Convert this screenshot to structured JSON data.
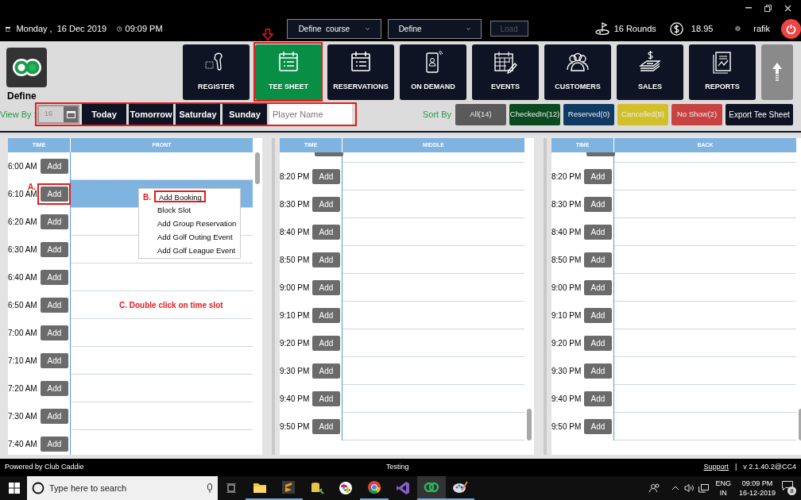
{
  "top_bar": {
    "date": "Monday ,  16 Dec 2019",
    "time": "09:09 PM",
    "course_select": "Define  course",
    "site_select": "Define",
    "load_button": {
      "label": "Load",
      "disabled": true
    },
    "rounds": "16 Rounds",
    "balance": "18.95",
    "user": "rafik"
  },
  "brand": {
    "name": "Define"
  },
  "nav": [
    {
      "label": "REGISTER",
      "selected": false
    },
    {
      "label": "TEE SHEET",
      "selected": true
    },
    {
      "label": "RESERVATIONS",
      "selected": false
    },
    {
      "label": "ON DEMAND",
      "selected": false
    },
    {
      "label": "EVENTS",
      "selected": false
    },
    {
      "label": "CUSTOMERS",
      "selected": false
    },
    {
      "label": "SALES",
      "selected": false
    },
    {
      "label": "REPORTS",
      "selected": false
    }
  ],
  "view_by": {
    "label": "View By :",
    "date_value": "16",
    "buttons": [
      "Today",
      "Tomorrow",
      "Saturday",
      "Sunday"
    ],
    "player_placeholder": "Player Name"
  },
  "sort_by": {
    "label": "Sort By",
    "filters": [
      {
        "label": "All(14)",
        "color": "#5a5a5a"
      },
      {
        "label": "CheckedIn(12)",
        "color": "#0a4a1e"
      },
      {
        "label": "Reserved(0)",
        "color": "#0e3a63"
      },
      {
        "label": "Cancelled(9)",
        "color": "#d2c02a"
      },
      {
        "label": "No Show(2)",
        "color": "#c84242"
      }
    ],
    "export_button": "Export Tee Sheet"
  },
  "panels": [
    {
      "time_header": "TIME",
      "course_header": "FRONT",
      "scrolled": false,
      "rows": [
        {
          "time": "6:00 AM",
          "button": "Add",
          "selected": false
        },
        {
          "time": "6:10 AM",
          "button": "Add",
          "selected": true
        },
        {
          "time": "6:20 AM",
          "button": "Add",
          "selected": false
        },
        {
          "time": "6:30 AM",
          "button": "Add",
          "selected": false
        },
        {
          "time": "6:40 AM",
          "button": "Add",
          "selected": false
        },
        {
          "time": "6:50 AM",
          "button": "Add",
          "selected": false
        },
        {
          "time": "7:00 AM",
          "button": "Add",
          "selected": false
        },
        {
          "time": "7:10 AM",
          "button": "Add",
          "selected": false
        },
        {
          "time": "7:20 AM",
          "button": "Add",
          "selected": false
        },
        {
          "time": "7:30 AM",
          "button": "Add",
          "selected": false
        },
        {
          "time": "7:40 AM",
          "button": "Add",
          "selected": false
        }
      ]
    },
    {
      "time_header": "TIME",
      "course_header": "MIDDLE",
      "scrolled": true,
      "rows": [
        {
          "time": "8:20 PM",
          "button": "Add",
          "selected": false
        },
        {
          "time": "8:30 PM",
          "button": "Add",
          "selected": false
        },
        {
          "time": "8:40 PM",
          "button": "Add",
          "selected": false
        },
        {
          "time": "8:50 PM",
          "button": "Add",
          "selected": false
        },
        {
          "time": "9:00 PM",
          "button": "Add",
          "selected": false
        },
        {
          "time": "9:10 PM",
          "button": "Add",
          "selected": false
        },
        {
          "time": "9:20 PM",
          "button": "Add",
          "selected": false
        },
        {
          "time": "9:30 PM",
          "button": "Add",
          "selected": false
        },
        {
          "time": "9:40 PM",
          "button": "Add",
          "selected": false
        },
        {
          "time": "9:50 PM",
          "button": "Add",
          "selected": false
        }
      ]
    },
    {
      "time_header": "TIME",
      "course_header": "BACK",
      "scrolled": true,
      "rows": [
        {
          "time": "8:20 PM",
          "button": "Add",
          "selected": false
        },
        {
          "time": "8:30 PM",
          "button": "Add",
          "selected": false
        },
        {
          "time": "8:40 PM",
          "button": "Add",
          "selected": false
        },
        {
          "time": "8:50 PM",
          "button": "Add",
          "selected": false
        },
        {
          "time": "9:00 PM",
          "button": "Add",
          "selected": false
        },
        {
          "time": "9:10 PM",
          "button": "Add",
          "selected": false
        },
        {
          "time": "9:20 PM",
          "button": "Add",
          "selected": false
        },
        {
          "time": "9:30 PM",
          "button": "Add",
          "selected": false
        },
        {
          "time": "9:40 PM",
          "button": "Add",
          "selected": false
        },
        {
          "time": "9:50 PM",
          "button": "Add",
          "selected": false
        }
      ]
    }
  ],
  "context_menu": {
    "items": [
      {
        "label": "Add Booking",
        "selected": true
      },
      {
        "label": "Block Slot",
        "selected": false
      },
      {
        "label": "Add Group Reservation",
        "selected": false
      },
      {
        "label": "Add Golf Outing Event",
        "selected": false
      },
      {
        "label": "Add Golf League Event",
        "selected": false
      }
    ]
  },
  "annotations": {
    "a": "A.",
    "b": "B.",
    "c": "C. Double click on time slot"
  },
  "footer": {
    "powered_by": "Powered by Club Caddie",
    "center": "Testing",
    "support_link": "Support",
    "separator": "|",
    "version": "v 2.1.40.2@CC4"
  },
  "taskbar": {
    "search_placeholder": "Type here to search",
    "language": "ENG",
    "region": "IN",
    "clock_time": "09:09 PM",
    "clock_date": "16-12-2019",
    "notifications": "8"
  }
}
